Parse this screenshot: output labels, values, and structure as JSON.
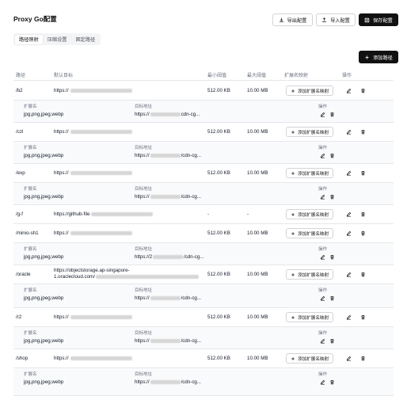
{
  "page": {
    "title": "Proxy Go配置"
  },
  "toolbar": {
    "export_label": "导出配置",
    "import_label": "导入配置",
    "save_label": "保存配置"
  },
  "tabs": [
    {
      "label": "路径映射",
      "active": true
    },
    {
      "label": "压缩设置",
      "active": false
    },
    {
      "label": "固定路径",
      "active": false
    }
  ],
  "add_path_label": "添加路径",
  "table": {
    "headers": {
      "path": "路径",
      "default_target": "默认目标",
      "min_threshold": "最小阈值",
      "max_threshold": "最大阈值",
      "ext_map": "扩展名映射",
      "actions": "操作"
    },
    "add_ext_label": "添加扩展名映射",
    "sub_headers": {
      "ext": "扩展名",
      "target": "目标地址",
      "actions": "操作"
    },
    "rows": [
      {
        "path": "/b2",
        "target": "https://",
        "min": "512.00 KB",
        "max": "10.00 MB",
        "ext": "jpg,png,jpeg,webp",
        "sub_target_prefix": "https://",
        "sub_target_suffix": "cdn-cg..."
      },
      {
        "path": "/czl",
        "target": "https://",
        "min": "512.00 KB",
        "max": "10.00 MB",
        "ext": "jpg,png,jpeg,webp",
        "sub_target_prefix": "https://",
        "sub_target_suffix": "/cdn-cg..."
      },
      {
        "path": "/exp",
        "target": "https://",
        "min": "512.00 KB",
        "max": "10.00 MB",
        "ext": "jpg,png,jpeg,webp",
        "sub_target_prefix": "https://",
        "sub_target_suffix": "/cdn-cg..."
      },
      {
        "path": "/g-f",
        "target": "https://github-file",
        "min": "-",
        "max": "-"
      },
      {
        "path": "/minio-sh1",
        "target": "https://",
        "min": "512.00 KB",
        "max": "10.00 MB",
        "ext": "jpg,png,jpeg,webp",
        "sub_target_prefix": "https://2",
        "sub_target_suffix": "/cdn-cg..."
      },
      {
        "path": "/oracle",
        "target": "https://objectstorage.ap-singapore-",
        "target_line2": "1.oraclecloud.com/",
        "min": "512.00 KB",
        "max": "10.00 MB",
        "ext": "jpg,png,jpeg,webp",
        "sub_target_prefix": "https://",
        "sub_target_suffix": "/cdn-cg..."
      },
      {
        "path": "/r2",
        "target": "https://",
        "min": "512.00 KB",
        "max": "10.00 MB",
        "ext": "jpg,png,jpeg,webp",
        "sub_target_prefix": "https://",
        "sub_target_suffix": "/cdn-cg..."
      },
      {
        "path": "/shop",
        "target": "https://",
        "min": "512.00 KB",
        "max": "10.00 MB",
        "ext": "jpg,png,jpeg,webp",
        "sub_target_prefix": "https://",
        "sub_target_suffix": "/cdn-cg..."
      }
    ]
  },
  "icons": {
    "export": "download-icon",
    "import": "upload-icon",
    "save": "save-icon",
    "add": "plus-icon",
    "edit": "edit-icon",
    "delete": "trash-icon"
  }
}
